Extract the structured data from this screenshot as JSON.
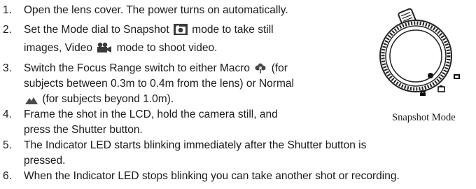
{
  "steps": [
    {
      "num": "1.",
      "lines": [
        "Open the lens cover. The power turns on automatically."
      ]
    },
    {
      "num": "2.",
      "a": "Set the Mode dial to Snapshot",
      "b": "mode to take still",
      "c": "images, Video",
      "d": "mode to shoot video."
    },
    {
      "num": "3.",
      "a": "Switch the Focus Range switch to either Macro",
      "b": "(for",
      "c": "subjects between 0.3m to 0.4m from the lens) or Normal",
      "d": "(for subjects beyond 1.0m)."
    },
    {
      "num": "4.",
      "a": "Frame the shot in the LCD, hold the camera still, and",
      "b": "press the Shutter button."
    },
    {
      "num": "5.",
      "a": "The Indicator LED starts blinking immediately after the Shutter button is",
      "b": "pressed."
    },
    {
      "num": "6.",
      "a": "When the Indicator LED stops blinking you can take another shot or recording."
    }
  ],
  "figure": {
    "caption": "Snapshot Mode"
  },
  "icons": {
    "snapshot": "camera-icon",
    "video": "movie-camera-icon",
    "macro": "flower-icon",
    "normal": "mountain-icon"
  }
}
